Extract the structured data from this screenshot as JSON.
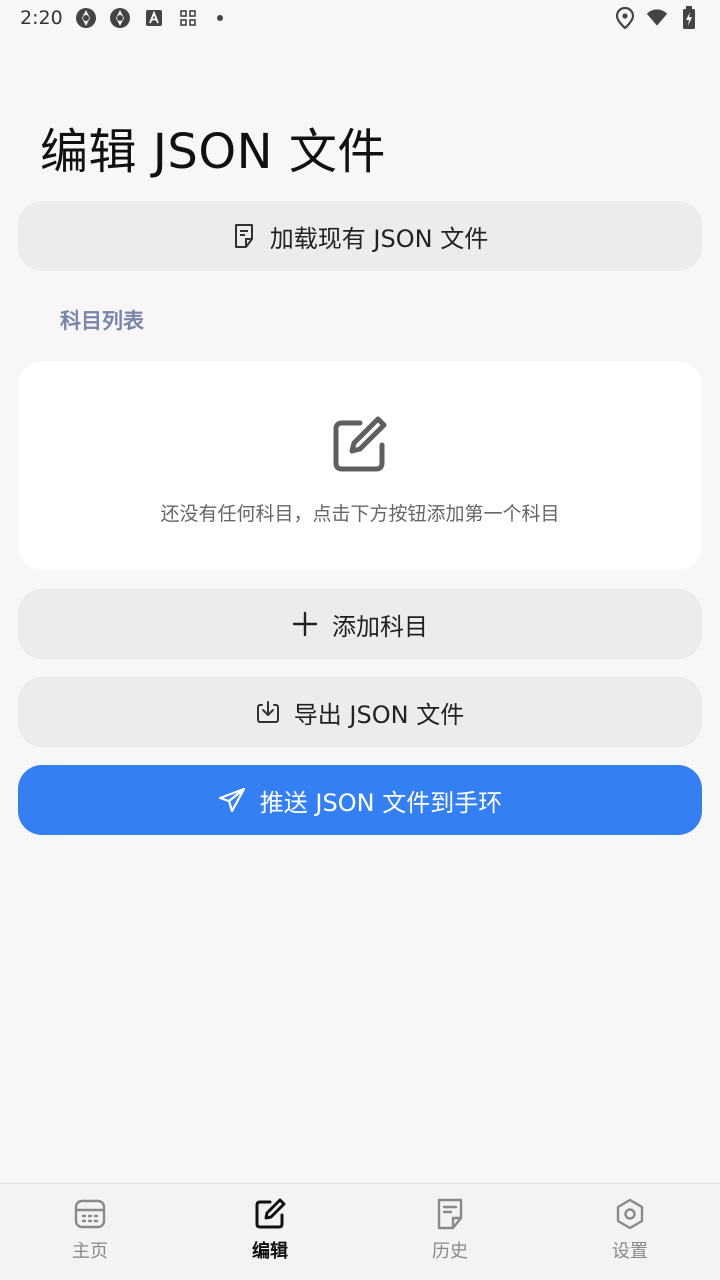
{
  "status_bar": {
    "time": "2:20",
    "icons_left": [
      "aperture-icon",
      "aperture-icon",
      "font-a-icon",
      "grid-icon",
      "dot-icon"
    ],
    "icons_right": [
      "location-pin-icon",
      "wifi-icon",
      "battery-charging-icon"
    ]
  },
  "page": {
    "title": "编辑 JSON 文件"
  },
  "actions": {
    "load_label": "加载现有 JSON 文件",
    "add_label": "添加科目",
    "export_label": "导出 JSON 文件",
    "push_label": "推送 JSON 文件到手环"
  },
  "subject_list": {
    "section_label": "科目列表",
    "empty_text": "还没有任何科目，点击下方按钮添加第一个科目"
  },
  "colors": {
    "primary": "#3480f3",
    "background": "#f7f7f7",
    "pill": "#ececec",
    "section_label": "#7a84a8"
  },
  "bottom_nav": {
    "items": [
      {
        "label": "主页",
        "icon": "calendar-icon",
        "active": false
      },
      {
        "label": "编辑",
        "icon": "edit-icon",
        "active": true
      },
      {
        "label": "历史",
        "icon": "document-icon",
        "active": false
      },
      {
        "label": "设置",
        "icon": "hexagon-settings-icon",
        "active": false
      }
    ]
  }
}
